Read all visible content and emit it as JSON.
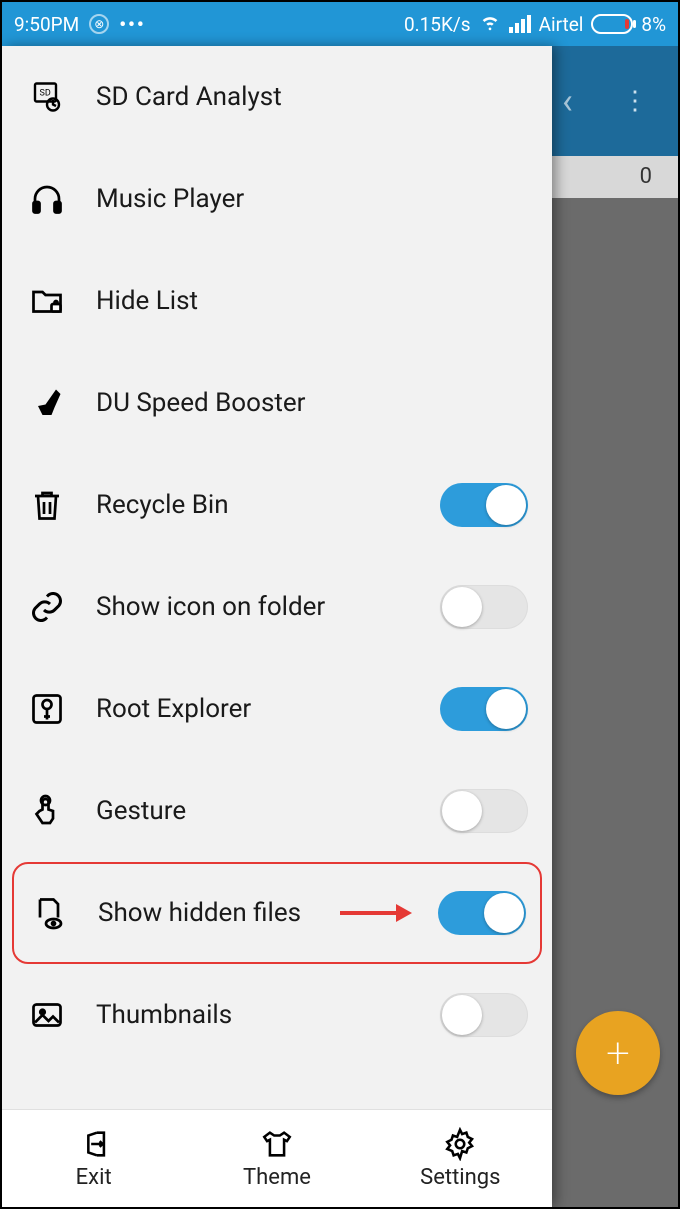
{
  "status": {
    "time": "9:50PM",
    "net_speed": "0.15K/s",
    "carrier": "Airtel",
    "battery_pct": "8%"
  },
  "background": {
    "visible_count": "0"
  },
  "menu": {
    "items": [
      {
        "label": "SD Card Analyst",
        "icon": "sd-card-icon",
        "toggle": null
      },
      {
        "label": "Music Player",
        "icon": "headphones-icon",
        "toggle": null
      },
      {
        "label": "Hide List",
        "icon": "folder-lock-icon",
        "toggle": null
      },
      {
        "label": "DU Speed Booster",
        "icon": "broom-icon",
        "toggle": null
      },
      {
        "label": "Recycle Bin",
        "icon": "trash-icon",
        "toggle": true
      },
      {
        "label": "Show icon on folder",
        "icon": "link-icon",
        "toggle": false
      },
      {
        "label": "Root Explorer",
        "icon": "key-square-icon",
        "toggle": true
      },
      {
        "label": "Gesture",
        "icon": "gesture-icon",
        "toggle": false
      },
      {
        "label": "Show hidden files",
        "icon": "file-eye-icon",
        "toggle": true,
        "highlighted": true
      },
      {
        "label": "Thumbnails",
        "icon": "image-icon",
        "toggle": false
      }
    ]
  },
  "bottom": {
    "exit": "Exit",
    "theme": "Theme",
    "settings": "Settings"
  }
}
